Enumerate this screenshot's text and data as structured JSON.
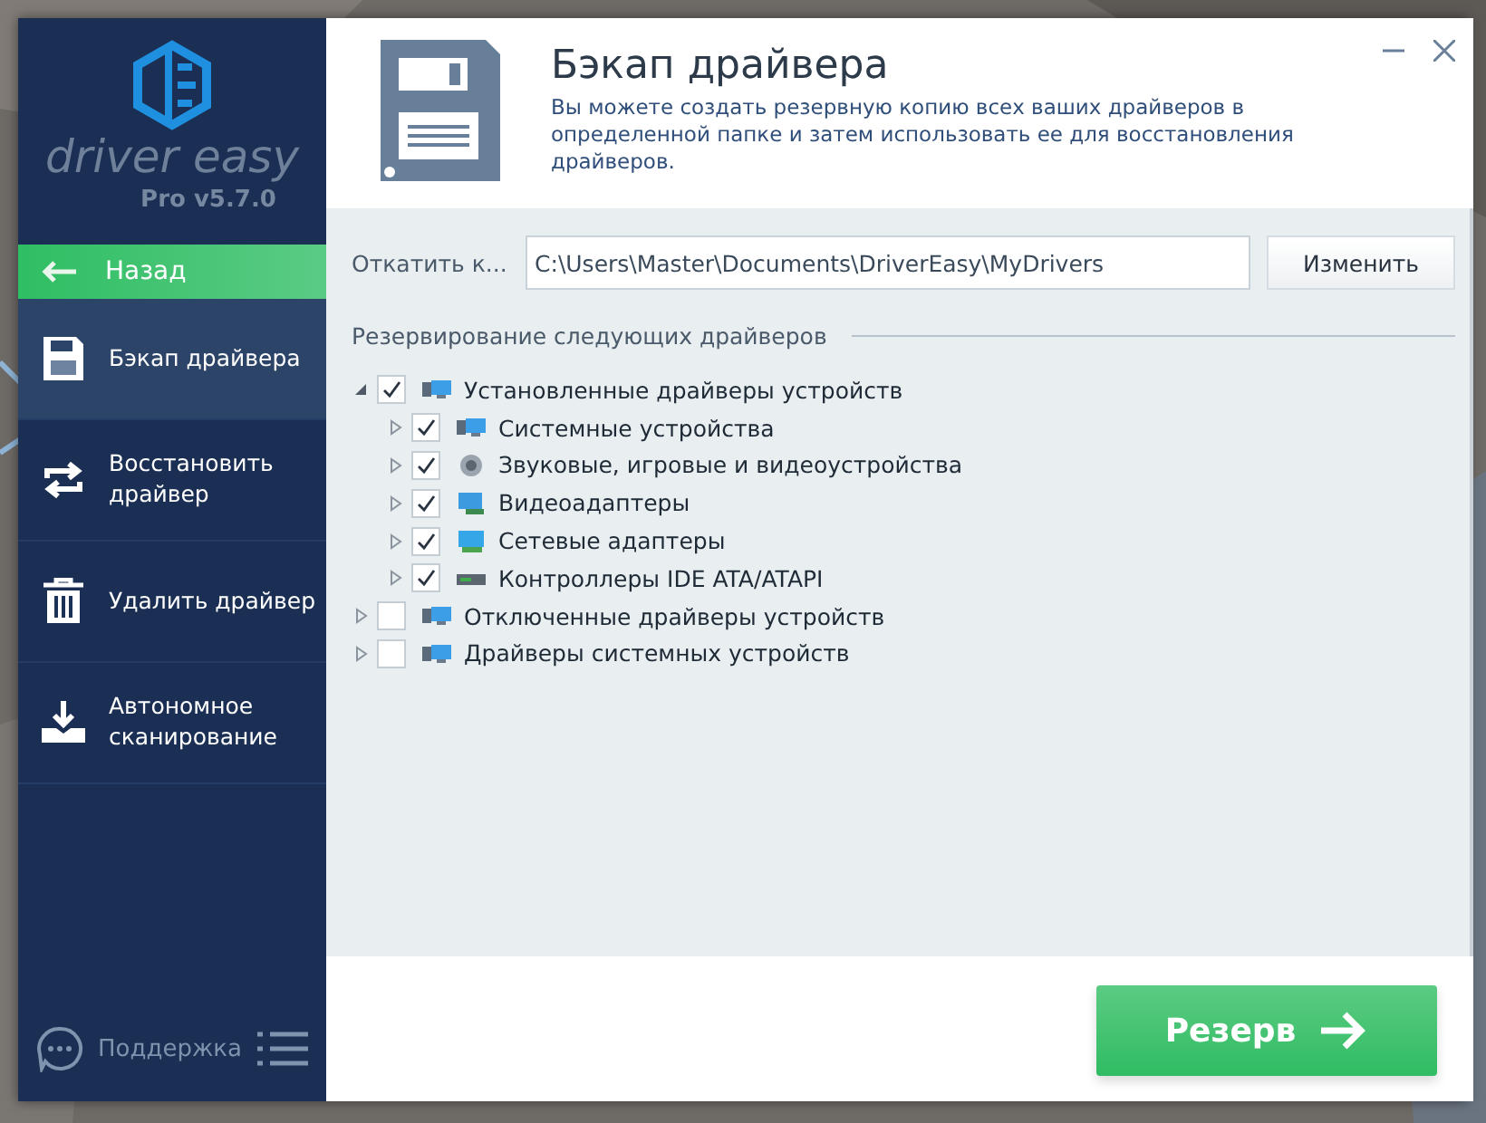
{
  "app": {
    "logo_text": "driver easy",
    "version": "Pro v5.7.0"
  },
  "back_button": {
    "label": "Назад"
  },
  "sidebar": {
    "items": [
      {
        "label": "Бэкап драйвера",
        "kind": "backup",
        "selected": true
      },
      {
        "label": "Восстановить драйвер",
        "kind": "restore",
        "selected": false
      },
      {
        "label": "Удалить драйвер",
        "kind": "delete",
        "selected": false
      },
      {
        "label": "Автономное сканирование",
        "kind": "scan",
        "selected": false
      }
    ],
    "support": "Поддержка"
  },
  "header": {
    "title": "Бэкап драйвера",
    "description": "Вы можете создать резервную копию всех ваших драйверов в определенной папке и затем использовать ее для восстановления драйверов."
  },
  "path_row": {
    "label": "Откатить к...",
    "value": "C:\\Users\\Master\\Documents\\DriverEasy\\MyDrivers",
    "button": "Изменить"
  },
  "section_title": "Резервирование следующих драйверов",
  "tree": [
    {
      "label": "Установленные драйверы устройств",
      "kind": "devices",
      "checked": true,
      "expanded": true,
      "children": [
        {
          "label": "Системные устройства",
          "kind": "devices",
          "checked": true,
          "expanded": false
        },
        {
          "label": "Звуковые, игровые и видеоустройства",
          "kind": "sound",
          "checked": true,
          "expanded": false
        },
        {
          "label": "Видеоадаптеры",
          "kind": "display",
          "checked": true,
          "expanded": false
        },
        {
          "label": "Сетевые адаптеры",
          "kind": "network",
          "checked": true,
          "expanded": false
        },
        {
          "label": "Контроллеры IDE ATA/ATAPI",
          "kind": "controller",
          "checked": true,
          "expanded": false
        }
      ]
    },
    {
      "label": "Отключенные драйверы устройств",
      "kind": "devices",
      "checked": false,
      "expanded": false
    },
    {
      "label": "Драйверы системных устройств",
      "kind": "devices",
      "checked": false,
      "expanded": false
    }
  ],
  "primary_button": {
    "label": "Резерв"
  }
}
